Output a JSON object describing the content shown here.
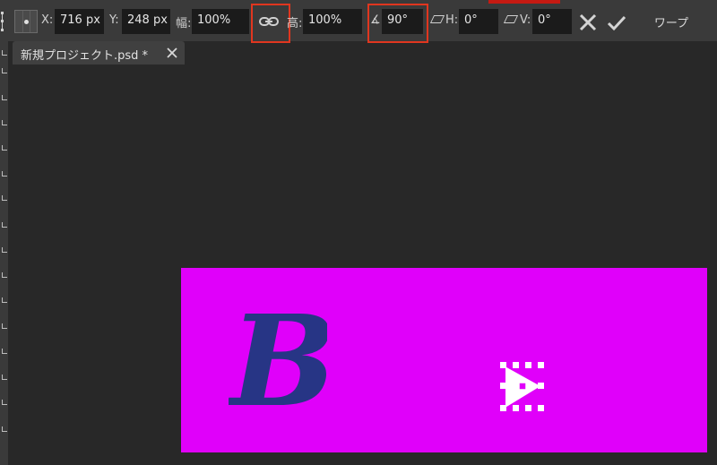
{
  "toolbar": {
    "x_label": "X:",
    "x_value": "716 px",
    "y_label": "Y:",
    "y_value": "248 px",
    "width_label": "幅:",
    "width_value": "100%",
    "link_icon": "chain-link-icon",
    "height_label": "高:",
    "height_value": "100%",
    "angle_label": "∡:",
    "angle_value": "90°",
    "skew_h_label": "H:",
    "skew_h_value": "0°",
    "skew_v_label": "V:",
    "skew_v_value": "0°",
    "cancel_icon": "close-x-icon",
    "commit_icon": "checkmark-icon",
    "warp_label": "ワープ"
  },
  "document": {
    "tab_title": "新規プロジェクト.psd *",
    "tab_close_icon": "close-icon"
  },
  "canvas": {
    "background_color": "#e000fa",
    "letter": "B",
    "letter_color": "#273585"
  },
  "colors": {
    "highlight": "#e0361f",
    "app_background": "#282828",
    "bar_background": "#3a3a3a"
  }
}
